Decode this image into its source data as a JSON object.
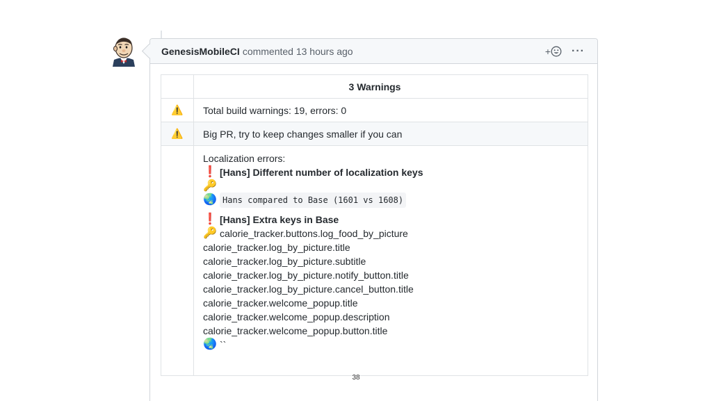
{
  "comment": {
    "author": "GenesisMobileCI",
    "meta": "commented 13 hours ago",
    "reaction_plus": "+",
    "more_label": "···"
  },
  "table": {
    "header": "3 Warnings",
    "warnings": [
      {
        "icon": "⚠️",
        "text": "Total build warnings: 19, errors: 0"
      },
      {
        "icon": "⚠️",
        "text": "Big PR, try to keep changes smaller if you can"
      }
    ],
    "localization": {
      "title": "Localization errors:",
      "error1": {
        "bang": "❗",
        "heading": "[Hans] Different number of localization keys",
        "key_icon": "🔑",
        "globe_icon": "🌏",
        "code": "Hans compared to Base (1601 vs 1608)"
      },
      "error2": {
        "bang": "❗",
        "heading": "[Hans] Extra keys in Base",
        "key_icon": "🔑",
        "first_key": "calorie_tracker.buttons.log_food_by_picture",
        "keys": [
          "calorie_tracker.log_by_picture.title",
          "calorie_tracker.log_by_picture.subtitle",
          "calorie_tracker.log_by_picture.notify_button.title",
          "calorie_tracker.log_by_picture.cancel_button.title",
          "calorie_tracker.welcome_popup.title",
          "calorie_tracker.welcome_popup.description",
          "calorie_tracker.welcome_popup.button.title"
        ],
        "globe_icon": "🌏",
        "tail": "``"
      }
    }
  },
  "page_number": "38"
}
